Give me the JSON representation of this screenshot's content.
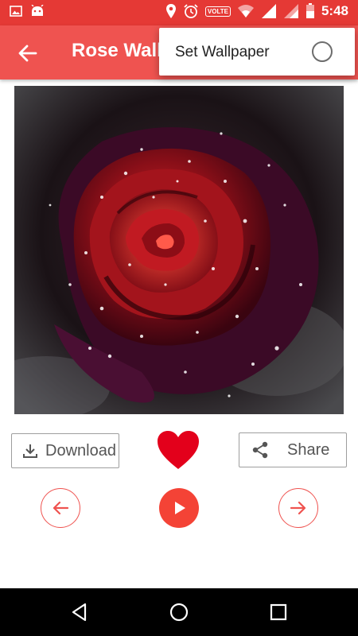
{
  "status_bar": {
    "time": "5:48",
    "volte": "VOLTE",
    "icons": [
      "image-icon",
      "android-icon",
      "location-icon",
      "alarm-icon",
      "wifi-icon",
      "signal-icon",
      "battery-icon"
    ]
  },
  "app_bar": {
    "title": "Rose Wall",
    "back_icon": "arrow-back-icon",
    "color": "#ef5350"
  },
  "menu": {
    "item_label": "Set Wallpaper",
    "selected": false
  },
  "wallpaper": {
    "description_icon": "rose-wallpaper-image"
  },
  "actions": {
    "download_label": "Download",
    "share_label": "Share",
    "favorite_icon": "heart-icon",
    "favorite_color": "#e3001b"
  },
  "navigation": {
    "prev_icon": "arrow-left-icon",
    "play_icon": "play-icon",
    "next_icon": "arrow-right-icon",
    "accent": "#f44336"
  },
  "system_nav": [
    "back-triangle-icon",
    "home-circle-icon",
    "recents-square-icon"
  ]
}
